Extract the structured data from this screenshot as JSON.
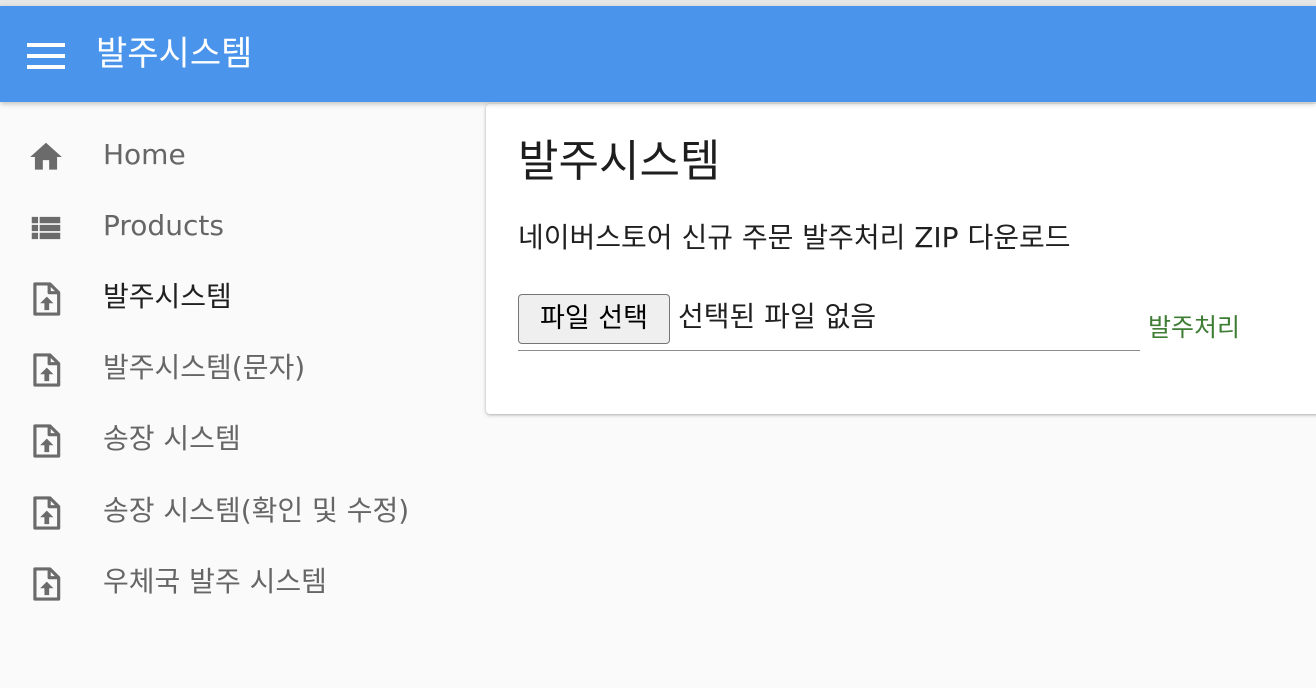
{
  "app": {
    "title": "발주시스템",
    "menu_icon": "hamburger-menu-icon",
    "header_color": "#4a94eb"
  },
  "sidebar": {
    "items": [
      {
        "label": "Home",
        "icon": "home-icon",
        "active": false
      },
      {
        "label": "Products",
        "icon": "list-icon",
        "active": false
      },
      {
        "label": "발주시스템",
        "icon": "file-upload-icon",
        "active": true
      },
      {
        "label": "발주시스템(문자)",
        "icon": "file-upload-icon",
        "active": false
      },
      {
        "label": "송장 시스템",
        "icon": "file-upload-icon",
        "active": false
      },
      {
        "label": "송장 시스템(확인 및 수정)",
        "icon": "file-upload-icon",
        "active": false
      },
      {
        "label": "우체국 발주 시스템",
        "icon": "file-upload-icon",
        "active": false
      }
    ]
  },
  "main": {
    "title": "발주시스템",
    "subtitle": "네이버스토어 신규 주문 발주처리 ZIP 다운로드",
    "file_button_label": "파일 선택",
    "file_status": "선택된 파일 없음",
    "submit_label": "발주처리",
    "submit_color": "#3e7d34"
  }
}
